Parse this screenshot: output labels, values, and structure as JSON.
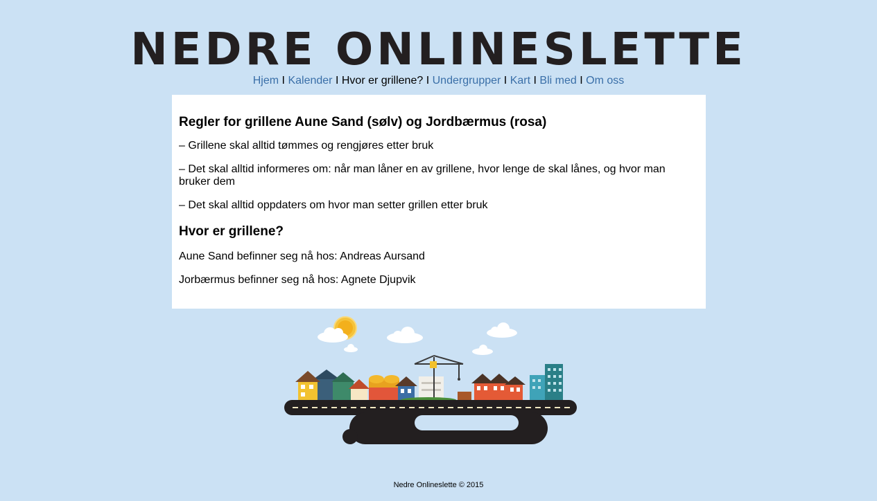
{
  "site": {
    "title": "NEDRE ONLINESLETTE"
  },
  "nav": {
    "items": [
      {
        "label": "Hjem"
      },
      {
        "label": "Kalender"
      },
      {
        "label": "Hvor er grillene?"
      },
      {
        "label": "Undergrupper"
      },
      {
        "label": "Kart"
      },
      {
        "label": "Bli med"
      },
      {
        "label": "Om oss"
      }
    ],
    "separator": "I"
  },
  "content": {
    "heading1": "Regler for grillene Aune Sand (sølv) og Jordbærmus (rosa)",
    "rules": [
      "– Grillene skal alltid tømmes og rengjøres etter bruk",
      "– Det skal alltid informeres om: når man låner en av grillene, hvor lenge de skal lånes, og hvor man bruker dem",
      "– Det skal alltid oppdaters om hvor man setter grillen etter bruk"
    ],
    "heading2": "Hvor er grillene?",
    "locations": [
      "Aune Sand befinner seg nå hos: Andreas Aursand",
      "Jorbærmus befinner seg nå hos: Agnete Djupvik"
    ]
  },
  "footer": {
    "text": "Nedre Onlineslette © 2015"
  },
  "colors": {
    "background": "#cbe1f4",
    "link": "#3a6fa8",
    "title": "#231f20",
    "road": "#231f20"
  }
}
